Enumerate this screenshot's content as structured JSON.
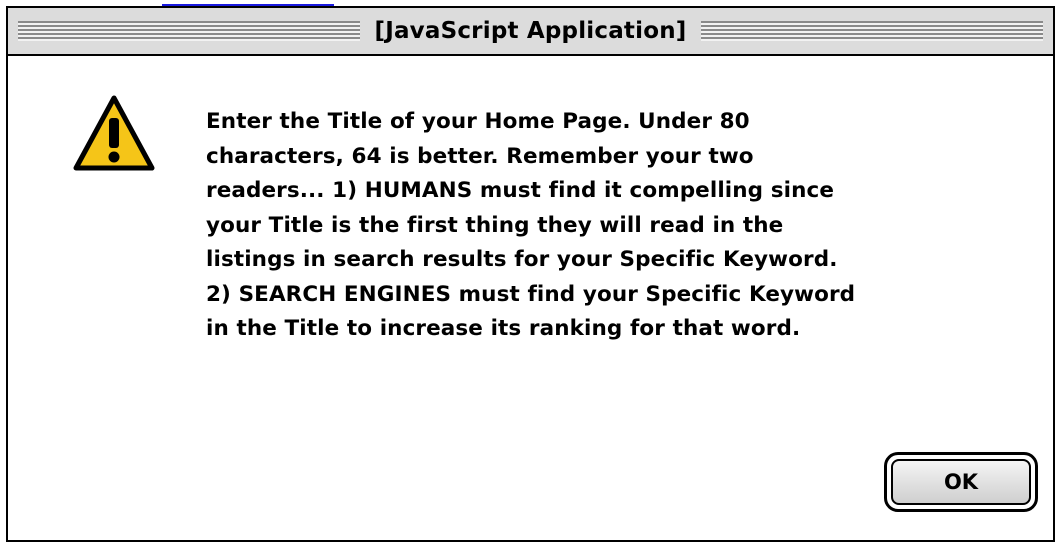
{
  "dialog": {
    "title": "[JavaScript Application]",
    "icon": "warning-icon",
    "message": "Enter the Title of your Home Page.  Under 80\ncharacters, 64 is better.  Remember your two\nreaders... 1) HUMANS must find it compelling since\nyour Title is the first thing they will read in the\nlistings in search results for your Specific Keyword.\n2) SEARCH ENGINES must find your Specific Keyword\nin the Title to increase its ranking for that word.",
    "ok_label": "OK"
  },
  "colors": {
    "titlebar": "#dcdcdc",
    "warning_fill": "#f5c518",
    "link": "#1a1ae0"
  }
}
